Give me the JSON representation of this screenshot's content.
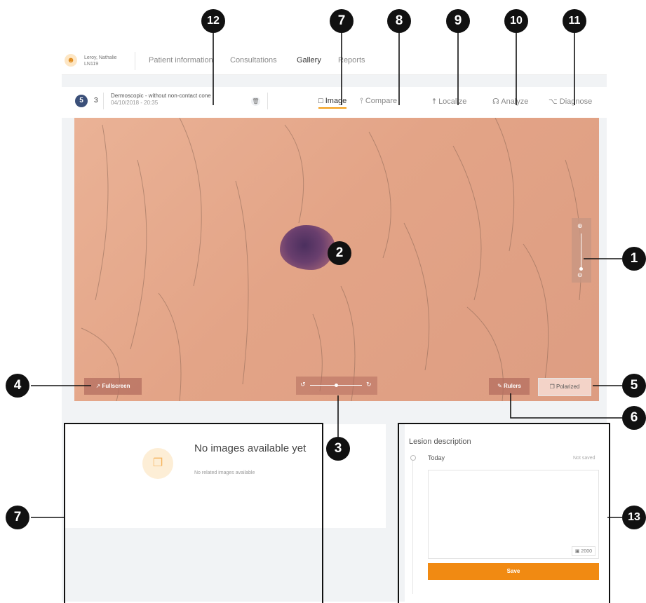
{
  "header": {
    "avatar_icon": "user-icon",
    "patient_name": "Leroy, Nathalie",
    "patient_id": "LN119",
    "nav": [
      "Patient information",
      "Consultations",
      "Gallery",
      "Reports"
    ]
  },
  "image_bar": {
    "badge": "5",
    "count": "3",
    "title": "Dermoscopic - without non-contact cone",
    "datetime": "04/10/2018 - 20:35",
    "tabs": [
      {
        "icon": "□",
        "label": "Image"
      },
      {
        "icon": "⫯",
        "label": "Compare"
      },
      {
        "icon": "☨",
        "label": "Localize"
      },
      {
        "icon": "☊",
        "label": "Analyze"
      },
      {
        "icon": "⌥",
        "label": "Diagnose"
      }
    ]
  },
  "viewer": {
    "fullscreen_label": "Fullscreen",
    "rulers_label": "Rulers",
    "polarized_label": "Polarized",
    "zoom_in_icon": "⊕",
    "zoom_out_icon": "⊖",
    "rotate_left_icon": "↺",
    "rotate_right_icon": "↻"
  },
  "related": {
    "title": "No images available yet",
    "subtitle": "No related images available"
  },
  "lesion": {
    "title": "Lesion description",
    "date": "Today",
    "status": "Not saved",
    "char_count": "2000",
    "save_label": "Save"
  },
  "callouts": [
    "1",
    "2",
    "3",
    "4",
    "5",
    "6",
    "7",
    "8",
    "9",
    "10",
    "11",
    "12",
    "7",
    "13"
  ],
  "colors": {
    "accent": "#f18a12",
    "badge": "#3b5079",
    "callout": "#111111"
  }
}
